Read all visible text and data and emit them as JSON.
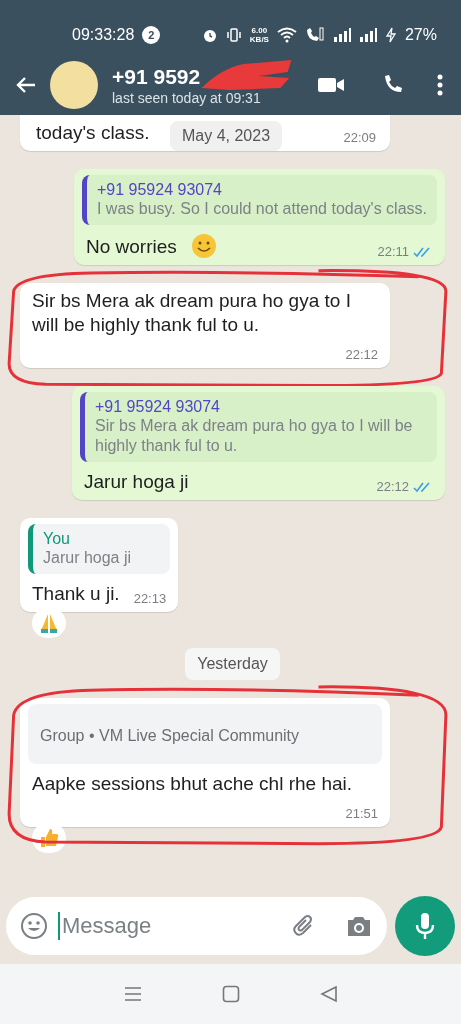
{
  "status_bar": {
    "time": "09:33:28",
    "notification_count": "2",
    "net_speed": "6.00",
    "net_unit": "KB/S",
    "battery": "27%"
  },
  "header": {
    "name": "+91 9592",
    "redacted": true,
    "subtitle": "last seen today at 09:31"
  },
  "sticky_date": "May 4, 2023",
  "messages": [
    {
      "kind": "incoming",
      "partial": true,
      "text": "today's class.",
      "time": "22:09",
      "circled": false
    },
    {
      "kind": "outgoing",
      "quote": {
        "author": "+91 95924 93074",
        "text": "I was busy. So I could not attend today's class.",
        "kind": "contact"
      },
      "text": "No worries",
      "emoji": {
        "kind": "smile"
      },
      "time": "22:11",
      "read": true,
      "circled": false
    },
    {
      "kind": "incoming",
      "text": "Sir bs Mera ak dream pura ho gya to I will be highly thank ful to u.",
      "time": "22:12",
      "circled": true
    },
    {
      "kind": "outgoing",
      "quote": {
        "author": "+91 95924 93074",
        "text": "Sir bs Mera ak dream pura ho gya to I will be highly thank ful to u.",
        "kind": "contact"
      },
      "text": "Jarur hoga ji",
      "time": "22:12",
      "read": true,
      "circled": false
    },
    {
      "kind": "incoming",
      "quote": {
        "author": "You",
        "text": "Jarur hoga ji",
        "kind": "self"
      },
      "text": "Thank u ji.",
      "time": "22:13",
      "reaction": {
        "kind": "folded-hands"
      },
      "circled": false
    },
    {
      "kind": "date",
      "text": "Yesterday"
    },
    {
      "kind": "incoming",
      "quote": {
        "text": "Group • VM Live Special Community",
        "kind": "group"
      },
      "text": "Aapke sessions bhut ache chl rhe hai.",
      "time": "21:51",
      "reaction": {
        "kind": "thumbs-up"
      },
      "circled": true
    }
  ],
  "composer": {
    "placeholder": "Message"
  }
}
